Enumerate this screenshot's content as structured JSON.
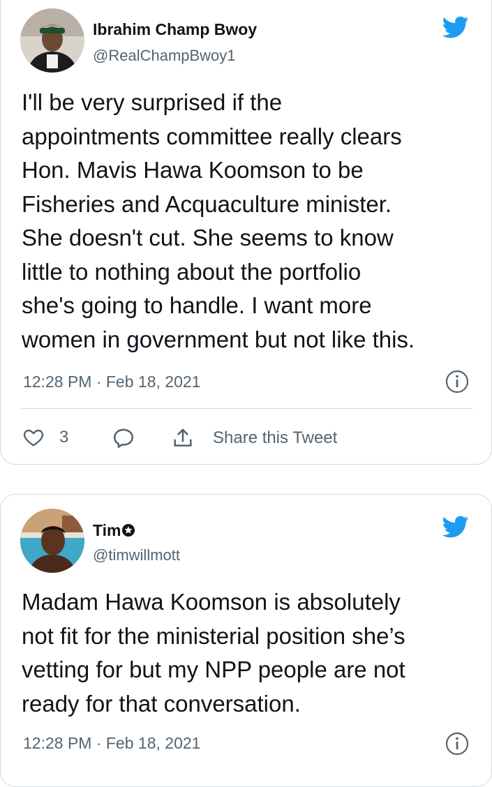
{
  "tweets": [
    {
      "user": {
        "name": "Ibrahim Champ Bwoy",
        "handle": "@RealChampBwoy1"
      },
      "text": "I'll be very surprised if the\nappointments committee really clears\nHon. Mavis Hawa Koomson to be\nFisheries and Acquaculture minister.\nShe doesn't cut. She seems to know\nlittle to nothing about the portfolio\nshe's going to handle. I want more\nwomen in government but not like this.",
      "timestamp": "12:28 PM · Feb 18, 2021",
      "likes": "3",
      "share_label": "Share this Tweet"
    },
    {
      "user": {
        "name": "Tim",
        "handle": "@timwillmott"
      },
      "text": "Madam Hawa Koomson is absolutely\nnot fit for the ministerial position she’s\nvetting for but my NPP people are not\nready for that conversation.",
      "timestamp": "12:28 PM · Feb 18, 2021"
    }
  ],
  "colors": {
    "twitter_blue": "#1d9bf0",
    "text": "#0f1419",
    "muted": "#536471",
    "border": "#cfd9de"
  },
  "icons": [
    "twitter-bird-icon",
    "info-icon",
    "heart-icon",
    "reply-bubble-icon",
    "share-icon",
    "verified-badge-icon"
  ]
}
